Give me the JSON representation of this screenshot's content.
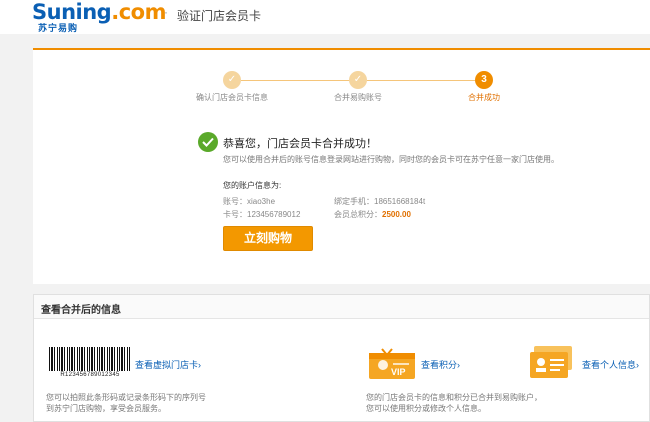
{
  "header": {
    "logo_main_s": "Suning",
    "logo_dot": ".",
    "logo_com": "com",
    "logo_sub": "苏宁易购",
    "separator": "·",
    "title": "验证门店会员卡"
  },
  "steps": [
    {
      "label": "确认门店会员卡信息",
      "state": "done",
      "mark": "✓"
    },
    {
      "label": "合并易购账号",
      "state": "done",
      "mark": "✓"
    },
    {
      "label": "合并成功",
      "state": "active",
      "mark": "3"
    }
  ],
  "success": {
    "title": "恭喜您，门店会员卡合并成功！",
    "desc": "您可以使用合并后的账号信息登录网站进行购物，同时您的会员卡可在苏宁任意一家门店使用。"
  },
  "account": {
    "title": "您的账户信息为:",
    "account_label": "账号：",
    "account_value": "xiao3he",
    "phone_label": "绑定手机：",
    "phone_value": "18651668184t",
    "card_label": "卡号：",
    "card_value": "123456789012",
    "points_label": "会员总积分：",
    "points_value": "2500.00"
  },
  "buy_button": "立刻购物",
  "info": {
    "title": "查看合并后的信息",
    "barcode_number": "R123456789012345",
    "virtual_card_link": "查看虚拟门店卡",
    "virtual_card_desc1": "您可以拍照此条形码或记录条形码下的序列号",
    "virtual_card_desc2": "到苏宁门店购物，享受会员服务。",
    "points_link": "查看积分",
    "vip_text": "VIP",
    "merge_desc1": "您的门店会员卡的信息和积分已合并到易购账户，",
    "merge_desc2": "您可以使用积分或修改个人信息。",
    "profile_link": "查看个人信息",
    "chevron": "›"
  },
  "colors": {
    "accent": "#f08d00",
    "brand_blue": "#0a5fb4",
    "success_green": "#5aa92a"
  }
}
